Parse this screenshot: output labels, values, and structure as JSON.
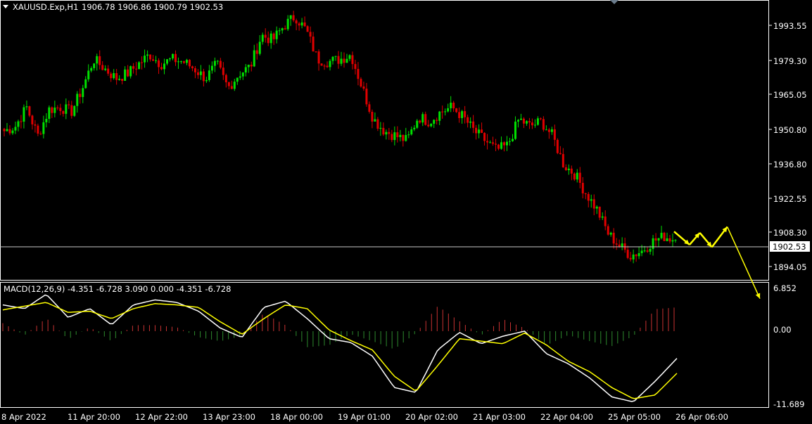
{
  "header": {
    "symbol": "XAUUSD.Exp,H1",
    "ohlc": "1906.78 1906.86 1900.79 1902.53"
  },
  "macd": {
    "label": "MACD(12,26,9) -4.351 -6.728 3.090 0.000 -4.351 -6.728",
    "axis_labels": [
      "6.852",
      "0.00",
      "-11.689"
    ]
  },
  "price_axis": {
    "labels": [
      "1993.55",
      "1979.30",
      "1965.05",
      "1950.80",
      "1936.80",
      "1922.55",
      "1908.30",
      "1894.05"
    ],
    "current_price": "1902.53"
  },
  "time_axis": {
    "labels": [
      "8 Apr 2022",
      "11 Apr 20:00",
      "12 Apr 22:00",
      "13 Apr 23:00",
      "18 Apr 00:00",
      "19 Apr 01:00",
      "20 Apr 02:00",
      "21 Apr 03:00",
      "22 Apr 04:00",
      "25 Apr 05:00",
      "26 Apr 06:00"
    ]
  },
  "colors": {
    "background": "#000000",
    "bull": "#00e000",
    "bear": "#e00000",
    "grid": "#ffffff",
    "arrows": "#ffff00",
    "macd_line": "#ffffff",
    "signal_line": "#ffff00",
    "hist_pos": "#c83232",
    "hist_neg": "#2e8b2e"
  },
  "chart_data": {
    "type": "candlestick",
    "title": "XAUUSD.Exp,H1",
    "x": [
      "8 Apr 2022",
      "11 Apr 20:00",
      "12 Apr 22:00",
      "13 Apr 23:00",
      "18 Apr 00:00",
      "19 Apr 01:00",
      "20 Apr 02:00",
      "21 Apr 03:00",
      "22 Apr 04:00",
      "25 Apr 05:00",
      "26 Apr 06:00"
    ],
    "close_path": [
      1948,
      1950,
      1958,
      1946,
      1957,
      1958,
      1956,
      1966,
      1978,
      1974,
      1970,
      1972,
      1976,
      1980,
      1976,
      1978,
      1977,
      1974,
      1970,
      1976,
      1966,
      1972,
      1975,
      1988,
      1986,
      1992,
      1996,
      1990,
      1978,
      1977,
      1978,
      1980,
      1966,
      1953,
      1948,
      1946,
      1944,
      1954,
      1952,
      1956,
      1958,
      1954,
      1948,
      1944,
      1940,
      1942,
      1953,
      1950,
      1952,
      1946,
      1934,
      1930,
      1922,
      1915,
      1905,
      1900,
      1896,
      1898,
      1902,
      1904,
      1902.53
    ],
    "price_range": [
      1887,
      2001
    ],
    "macd": {
      "line_path": [
        4.2,
        3.6,
        5.9,
        2.2,
        3.6,
        1.0,
        4.2,
        5.0,
        4.6,
        3.2,
        0.5,
        -1.0,
        3.8,
        4.8,
        2.0,
        -1.2,
        -1.8,
        -4.0,
        -9.0,
        -9.8,
        -3.0,
        -0.2,
        -2.0,
        -0.8,
        0.0,
        -3.6,
        -5.2,
        -7.5,
        -10.5,
        -11.3,
        -8.0,
        -4.351
      ],
      "signal_path": [
        3.4,
        4.0,
        4.6,
        3.0,
        3.2,
        2.0,
        3.6,
        4.4,
        4.2,
        3.8,
        1.5,
        -0.5,
        2.0,
        4.2,
        3.6,
        0.2,
        -1.5,
        -3.0,
        -7.2,
        -9.6,
        -5.5,
        -1.2,
        -1.6,
        -2.0,
        -0.3,
        -2.2,
        -4.8,
        -6.5,
        -9.0,
        -10.8,
        -10.2,
        -6.728
      ],
      "range": [
        -11.689,
        6.852
      ]
    },
    "projection_arrows": [
      {
        "from": [
          0.0,
          1906.0
        ],
        "to": [
          0.18,
          1900.5
        ]
      },
      {
        "from": [
          0.18,
          1900.5
        ],
        "to": [
          0.3,
          1905.5
        ]
      },
      {
        "from": [
          0.3,
          1905.5
        ],
        "to": [
          0.44,
          1899.5
        ]
      },
      {
        "from": [
          0.44,
          1899.5
        ],
        "to": [
          0.62,
          1908.0
        ]
      },
      {
        "from": [
          0.62,
          1908.0
        ],
        "to": [
          1.0,
          1878.0
        ]
      }
    ]
  }
}
